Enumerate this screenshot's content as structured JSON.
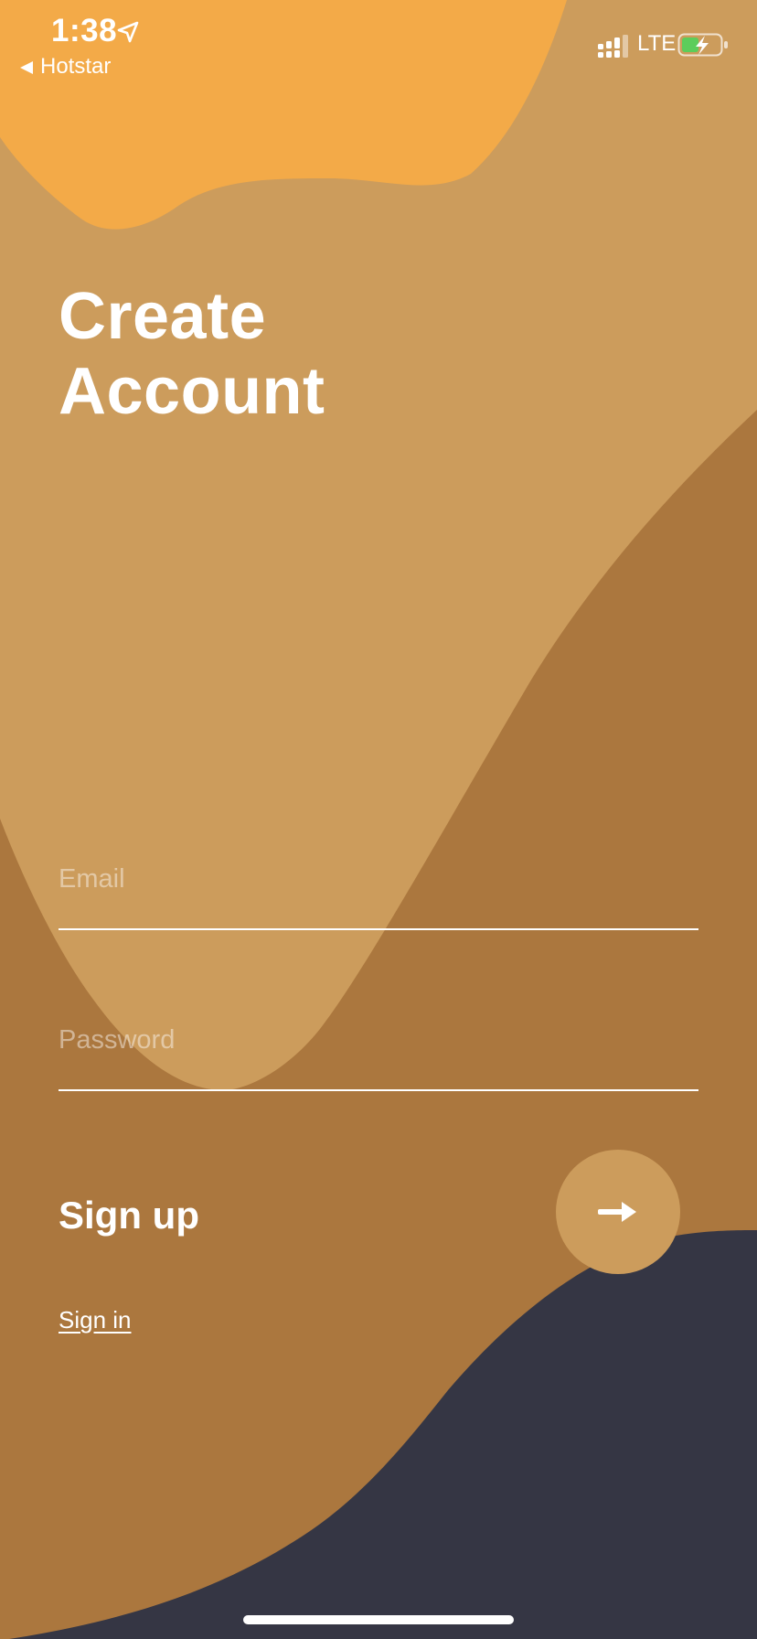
{
  "status_bar": {
    "time": "1:38",
    "back_app": "Hotstar",
    "network": "LTE"
  },
  "title": {
    "line1": "Create",
    "line2": "Account"
  },
  "form": {
    "email_placeholder": "Email",
    "password_placeholder": "Password"
  },
  "actions": {
    "signup_label": "Sign up",
    "signin_link": "Sign in"
  },
  "colors": {
    "orange": "#f3aa48",
    "tan": "#cc9c5c",
    "brown": "#ab773e",
    "navy": "#353644"
  },
  "icons": [
    "location-arrow-icon",
    "back-arrow-icon",
    "signal-icon",
    "battery-charging-icon",
    "arrow-right-icon"
  ]
}
